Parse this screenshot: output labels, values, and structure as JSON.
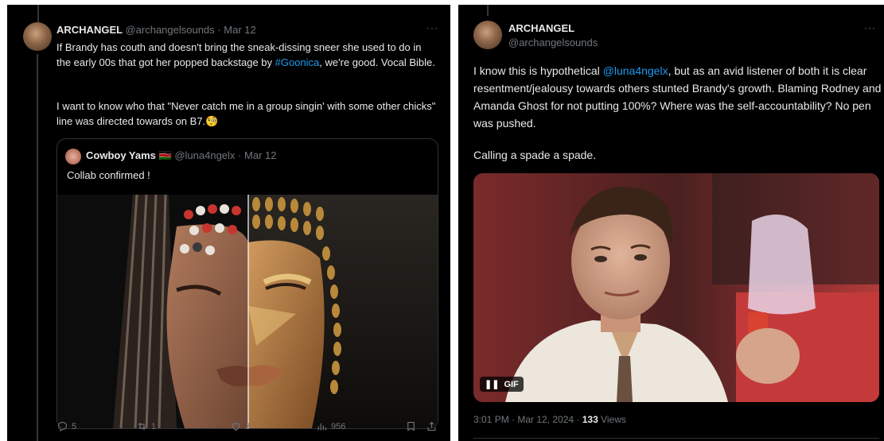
{
  "left_post": {
    "author_name": "ARCHANGEL",
    "author_handle": "@archangelsounds",
    "separator": "·",
    "date": "Mar 12",
    "menu_dots": "···",
    "text_part1": "If Brandy has couth and doesn't bring the sneak-dissing sneer she used to do in the early 00s that got her popped backstage by ",
    "hashtag": "#Goonica",
    "text_part2": ", we're good. Vocal Bible.",
    "text_para2": "I want to know who that \"Never catch me in a group singin' with some other chicks\" line was directed towards on B7.🧐",
    "quote": {
      "author_name": "Cowboy Yams 🇰🇪",
      "author_handle": "@luna4ngelx",
      "separator": "·",
      "date": "Mar 12",
      "text": "Collab confirmed !"
    },
    "actions": {
      "replies": "5",
      "reposts": "1",
      "likes": "3",
      "views": "956"
    }
  },
  "right_post": {
    "author_name": "ARCHANGEL",
    "author_handle": "@archangelsounds",
    "menu_dots": "···",
    "text_part1": "I know this is hypothetical ",
    "mention": "@luna4ngelx",
    "text_part2": ", but as an avid listener of both it is clear resentment/jealousy towards others stunted Brandy's growth. Blaming Rodney and Amanda Ghost for not putting 100%? Where was the self-accountability? No pen was pushed.",
    "text_para2": "Calling a spade a spade.",
    "gif_label": "GIF",
    "timestamp": "3:01 PM · Mar 12, 2024 · ",
    "views_count": "133",
    "views_label": " Views"
  },
  "colors": {
    "background": "#000000",
    "text": "#e7e9ea",
    "muted": "#71767b",
    "link": "#1d9bf0",
    "border": "#2f3336"
  }
}
